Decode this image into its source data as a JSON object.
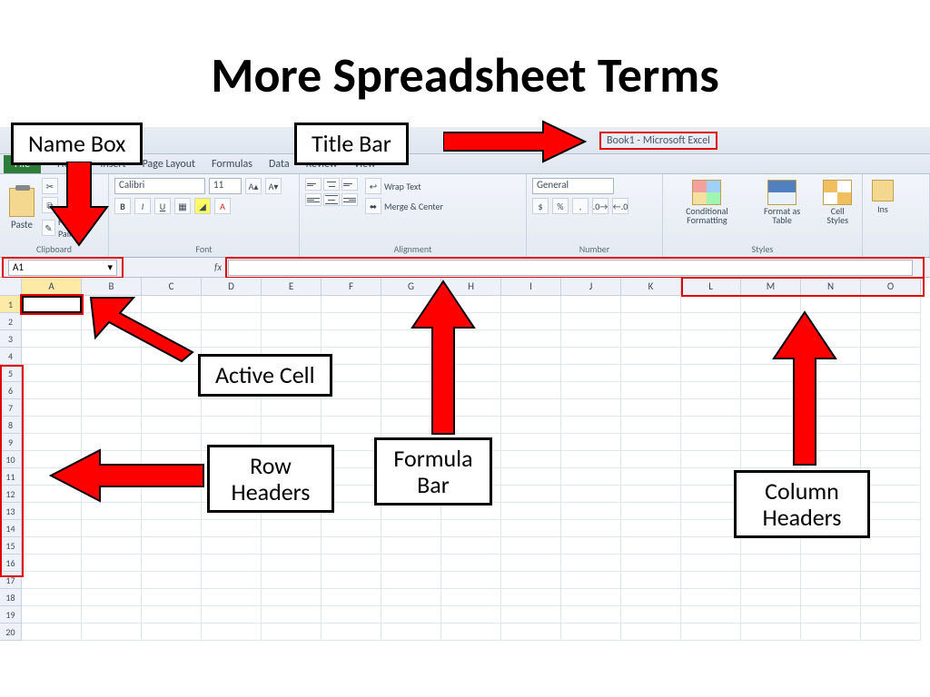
{
  "slide": {
    "title": "More Spreadsheet Terms"
  },
  "excel": {
    "titlebar": "Book1  -  Microsoft Excel",
    "ribbon_tabs": [
      "File",
      "Home",
      "Insert",
      "Page Layout",
      "Formulas",
      "Data",
      "Review",
      "View"
    ],
    "clipboard": {
      "paste": "Paste",
      "format_painter": "Format Painter",
      "label": "Clipboard"
    },
    "font": {
      "name": "Calibri",
      "size": "11",
      "label": "Font"
    },
    "alignment": {
      "wrap": "Wrap Text",
      "merge": "Merge & Center",
      "label": "Alignment"
    },
    "number": {
      "format": "General",
      "label": "Number"
    },
    "styles": {
      "cond": "Conditional Formatting",
      "table": "Format as Table",
      "cell": "Cell Styles",
      "label": "Styles"
    },
    "name_box": "A1",
    "fx": "fx",
    "columns": [
      "A",
      "B",
      "C",
      "D",
      "E",
      "F",
      "G",
      "H",
      "I",
      "J",
      "K",
      "L",
      "M",
      "N",
      "O"
    ],
    "rows": [
      "1",
      "2",
      "3",
      "4",
      "5",
      "6",
      "7",
      "8",
      "9",
      "10",
      "11",
      "12",
      "13",
      "14",
      "15",
      "16",
      "17",
      "18",
      "19",
      "20"
    ]
  },
  "callouts": {
    "name_box": "Name Box",
    "title_bar": "Title Bar",
    "active_cell": "Active Cell",
    "formula_bar": "Formula Bar",
    "row_headers": "Row Headers",
    "column_headers": "Column Headers"
  }
}
